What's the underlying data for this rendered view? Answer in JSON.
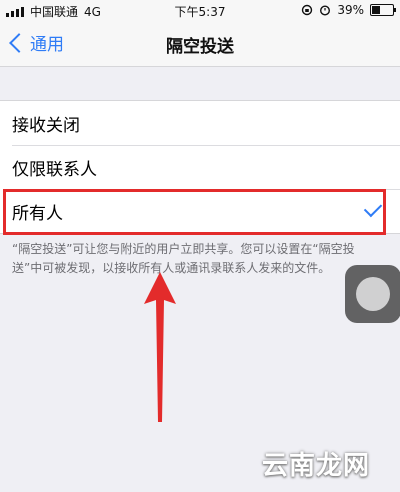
{
  "status_bar": {
    "carrier": "中国联通",
    "network": "4G",
    "time": "下午5:37",
    "battery": "39%",
    "battery_level": 0.39
  },
  "nav": {
    "back_label": "通用",
    "title": "隔空投送"
  },
  "options": [
    {
      "label": "接收关闭",
      "selected": false
    },
    {
      "label": "仅限联系人",
      "selected": false
    },
    {
      "label": "所有人",
      "selected": true
    }
  ],
  "footer_note": "“隔空投送”可让您与附近的用户立即共享。您可以设置在“隔空投送”中可被发现，以接收所有人或通讯录联系人发来的文件。",
  "watermark": "云南龙网",
  "colors": {
    "accent": "#2f7cf6",
    "highlight": "#e32b2b",
    "background": "#efeff4"
  }
}
